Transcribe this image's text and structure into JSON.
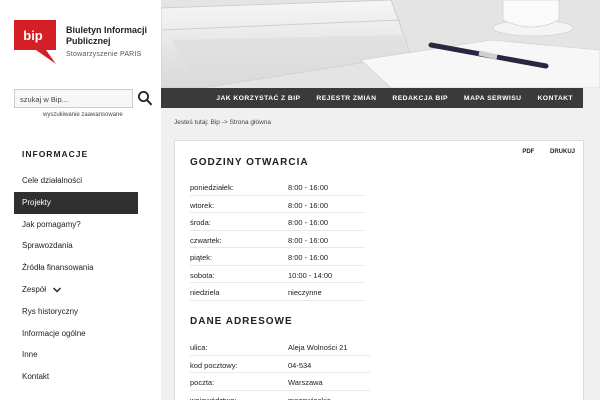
{
  "brand": {
    "logo_text": "bip",
    "title": "Biuletyn Informacji Publicznej",
    "subtitle": "Stowarzyszenie PARIS"
  },
  "search": {
    "placeholder": "szukaj w Bip...",
    "advanced_label": "wyszukiwanie zaawansowane"
  },
  "sidebar": {
    "header": "INFORMACJE",
    "items": [
      {
        "label": "Cele działalności"
      },
      {
        "label": "Projekty"
      },
      {
        "label": "Jak pomagamy?"
      },
      {
        "label": "Sprawozdania"
      },
      {
        "label": "Źródła finansowania"
      },
      {
        "label": "Zespół"
      },
      {
        "label": "Rys historyczny"
      },
      {
        "label": "Informacje ogólne"
      },
      {
        "label": "Inne"
      },
      {
        "label": "Kontakt"
      }
    ]
  },
  "topnav": {
    "items": [
      "JAK KORZYSTAĆ Z BIP",
      "REJESTR ZMIAN",
      "REDAKCJA BIP",
      "MAPA SERWISU",
      "KONTAKT"
    ]
  },
  "breadcrumb": "Jesteś tutaj: Bip -> Strona główna",
  "tools": {
    "pdf": "PDF",
    "print": "DRUKUJ"
  },
  "hours": {
    "title": "GODZINY OTWARCIA",
    "rows": [
      {
        "day": "poniedziałek:",
        "time": "8:00 - 16:00"
      },
      {
        "day": "wtorek:",
        "time": "8:00 - 16:00"
      },
      {
        "day": "środa:",
        "time": "8:00 - 16:00"
      },
      {
        "day": "czwartek:",
        "time": "8:00 - 16:00"
      },
      {
        "day": "piątek:",
        "time": "8:00 - 16:00"
      },
      {
        "day": "sobota:",
        "time": "10:00 - 14:00"
      },
      {
        "day": "niedziela",
        "time": "nieczynne"
      }
    ]
  },
  "address": {
    "title": "DANE ADRESOWE",
    "rows": [
      {
        "key": "ulica:",
        "value": "Aleja Wolności 21"
      },
      {
        "key": "kod pocztowy:",
        "value": "04-534"
      },
      {
        "key": "poczta:",
        "value": "Warszawa"
      },
      {
        "key": "województwo:",
        "value": "mazowieckie"
      }
    ]
  },
  "colors": {
    "bip_red": "#d51f26",
    "nav_dark": "#3a3a3a",
    "active_item": "#2f2f2f"
  }
}
